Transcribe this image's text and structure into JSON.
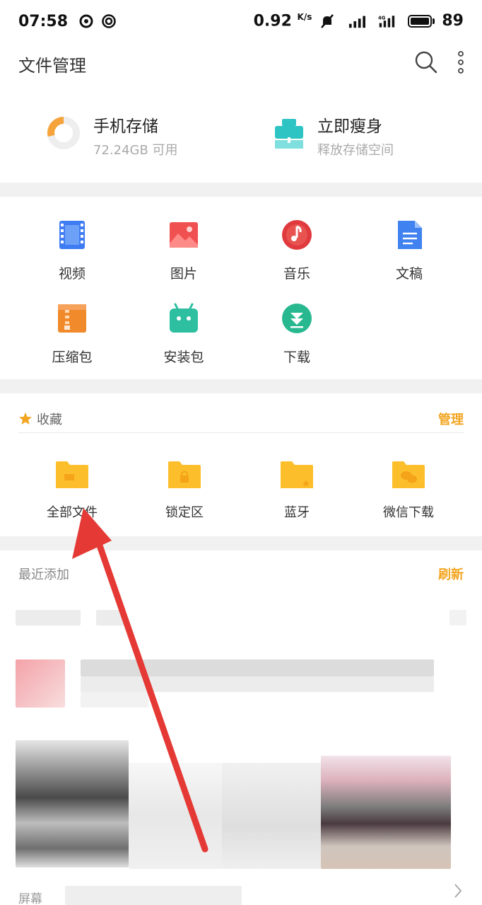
{
  "status_bar": {
    "time": "07:58",
    "speed": "0.92",
    "speed_unit": "K/s",
    "battery": "89"
  },
  "appbar": {
    "title": "文件管理",
    "search_icon": "search-icon",
    "more_icon": "more-vertical-icon"
  },
  "storage": {
    "phone": {
      "title": "手机存储",
      "subtitle": "72.24GB 可用",
      "icon": "storage-ring-icon"
    },
    "slim": {
      "title": "立即瘦身",
      "subtitle": "释放存储空间",
      "icon": "broom-icon"
    }
  },
  "categories": [
    {
      "label": "视频",
      "icon": "video-icon",
      "color": "#3d7cf2"
    },
    {
      "label": "图片",
      "icon": "image-icon",
      "color": "#f0504f"
    },
    {
      "label": "音乐",
      "icon": "music-icon",
      "color": "#e8403f"
    },
    {
      "label": "文稿",
      "icon": "document-icon",
      "color": "#3f82f0"
    },
    {
      "label": "压缩包",
      "icon": "archive-icon",
      "color": "#f08a2a"
    },
    {
      "label": "安装包",
      "icon": "android-icon",
      "color": "#2dbfa0"
    },
    {
      "label": "下载",
      "icon": "download-icon",
      "color": "#27b88f"
    }
  ],
  "favorites": {
    "title": "收藏",
    "manage": "管理",
    "items": [
      {
        "label": "全部文件",
        "icon": "folder-icon"
      },
      {
        "label": "锁定区",
        "icon": "locked-folder-icon"
      },
      {
        "label": "蓝牙",
        "icon": "bluetooth-folder-icon"
      },
      {
        "label": "微信下载",
        "icon": "wechat-folder-icon"
      }
    ]
  },
  "recent": {
    "title": "最近添加",
    "refresh": "刷新",
    "screen_label": "屏幕"
  },
  "colors": {
    "accent": "#f3a521",
    "folder": "#fcbf2b",
    "annotation_arrow": "#e53935"
  }
}
